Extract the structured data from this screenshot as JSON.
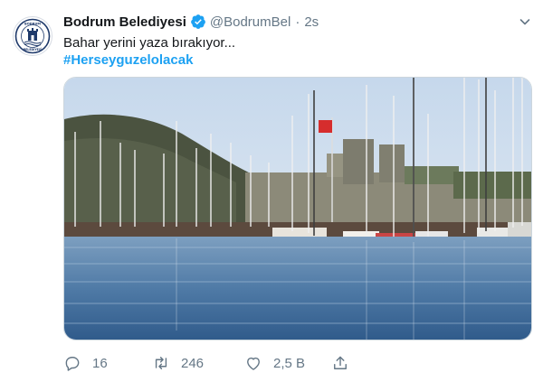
{
  "tweet": {
    "author_name": "Bodrum Belediyesi",
    "handle": "@BodrumBel",
    "separator": "·",
    "time": "2s",
    "text": "Bahar yerini yaza bırakıyor...",
    "hashtag": "#Herseyguzelolacak"
  },
  "avatar": {
    "icon": "municipality-emblem-icon",
    "ring_text_top": "BODRUM",
    "ring_text_bottom": "BELEDİYESİ"
  },
  "media": {
    "icon": "harbor-photo"
  },
  "actions": {
    "reply_count": "16",
    "retweet_count": "246",
    "like_count": "2,5 B",
    "share_icon": "share-icon"
  },
  "colors": {
    "accent": "#1da1f2",
    "secondary_text": "#657786",
    "primary_text": "#14171a",
    "verified_badge": "#1da1f2",
    "emblem": "#1f3a6b"
  }
}
